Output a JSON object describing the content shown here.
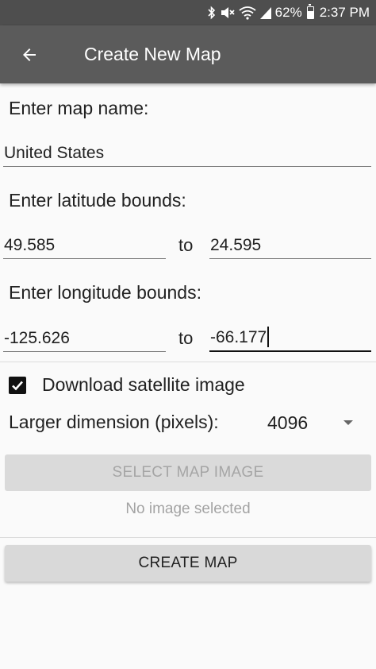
{
  "status_bar": {
    "battery": "62%",
    "time": "2:37 PM",
    "icons": [
      "bluetooth-icon",
      "mute-icon",
      "wifi-icon",
      "signal-icon",
      "battery-icon"
    ]
  },
  "app_bar": {
    "title": "Create New Map",
    "back_icon": "arrow-back-icon",
    "background": "#5b5b5b"
  },
  "form": {
    "map_name_label": "Enter map name:",
    "map_name_value": "United States",
    "latitude_label": "Enter latitude bounds:",
    "lat_from": "49.585",
    "lat_to": "24.595",
    "longitude_label": "Enter longitude bounds:",
    "lon_from": "-125.626",
    "lon_to": "-66.177",
    "to_text": "to",
    "download_satellite_label": "Download satellite image",
    "download_satellite_checked": true,
    "dimension_label": "Larger dimension (pixels):",
    "dimension_value": "4096",
    "select_image_button": "SELECT MAP IMAGE",
    "no_image_text": "No image selected",
    "create_map_button": "CREATE MAP"
  }
}
